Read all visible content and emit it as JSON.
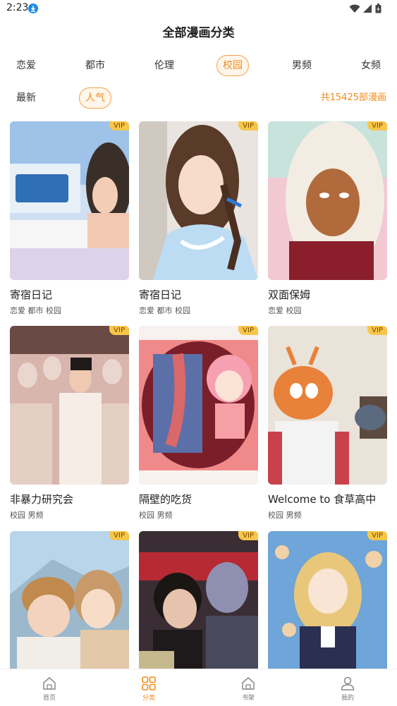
{
  "status": {
    "time": "2:23"
  },
  "page_title": "全部漫画分类",
  "categories": [
    {
      "label": "恋爱"
    },
    {
      "label": "都市"
    },
    {
      "label": "伦理"
    },
    {
      "label": "校园"
    },
    {
      "label": "男频"
    },
    {
      "label": "女频"
    }
  ],
  "active_category": "校园",
  "sorts": [
    {
      "label": "最新"
    },
    {
      "label": "人气"
    }
  ],
  "active_sort": "人气",
  "total_count": "共15425部漫画",
  "vip_label": "VIP",
  "comics": [
    {
      "title": "寄宿日记",
      "tags": "恋爱 都市 校园",
      "cover_color": "#cfe0f2"
    },
    {
      "title": "寄宿日记",
      "tags": "恋爱 都市 校园",
      "cover_color": "#e9e4df"
    },
    {
      "title": "双面保姆",
      "tags": "恋爱 校园",
      "cover_color": "#f2c9d2"
    },
    {
      "title": "非暴力研究会",
      "tags": "校园 男频",
      "cover_color": "#d8b5ad"
    },
    {
      "title": "隔壁的吃货",
      "tags": "校园 男频",
      "cover_color": "#f08a8a"
    },
    {
      "title": "Welcome to 食草高中",
      "tags": "校园 男频",
      "cover_color": "#e8823a"
    },
    {
      "title": "",
      "tags": "",
      "cover_color": "#b9d5ea"
    },
    {
      "title": "",
      "tags": "",
      "cover_color": "#3a2e34"
    },
    {
      "title": "",
      "tags": "",
      "cover_color": "#6fa5d8"
    }
  ],
  "nav": [
    {
      "label": "首页",
      "icon": "home-icon"
    },
    {
      "label": "分类",
      "icon": "category-grid-icon"
    },
    {
      "label": "书架",
      "icon": "bookshelf-icon"
    },
    {
      "label": "我的",
      "icon": "user-icon"
    }
  ],
  "active_nav": "分类",
  "colors": {
    "accent": "#f08a1c",
    "vip_bg": "#f7c64a"
  }
}
